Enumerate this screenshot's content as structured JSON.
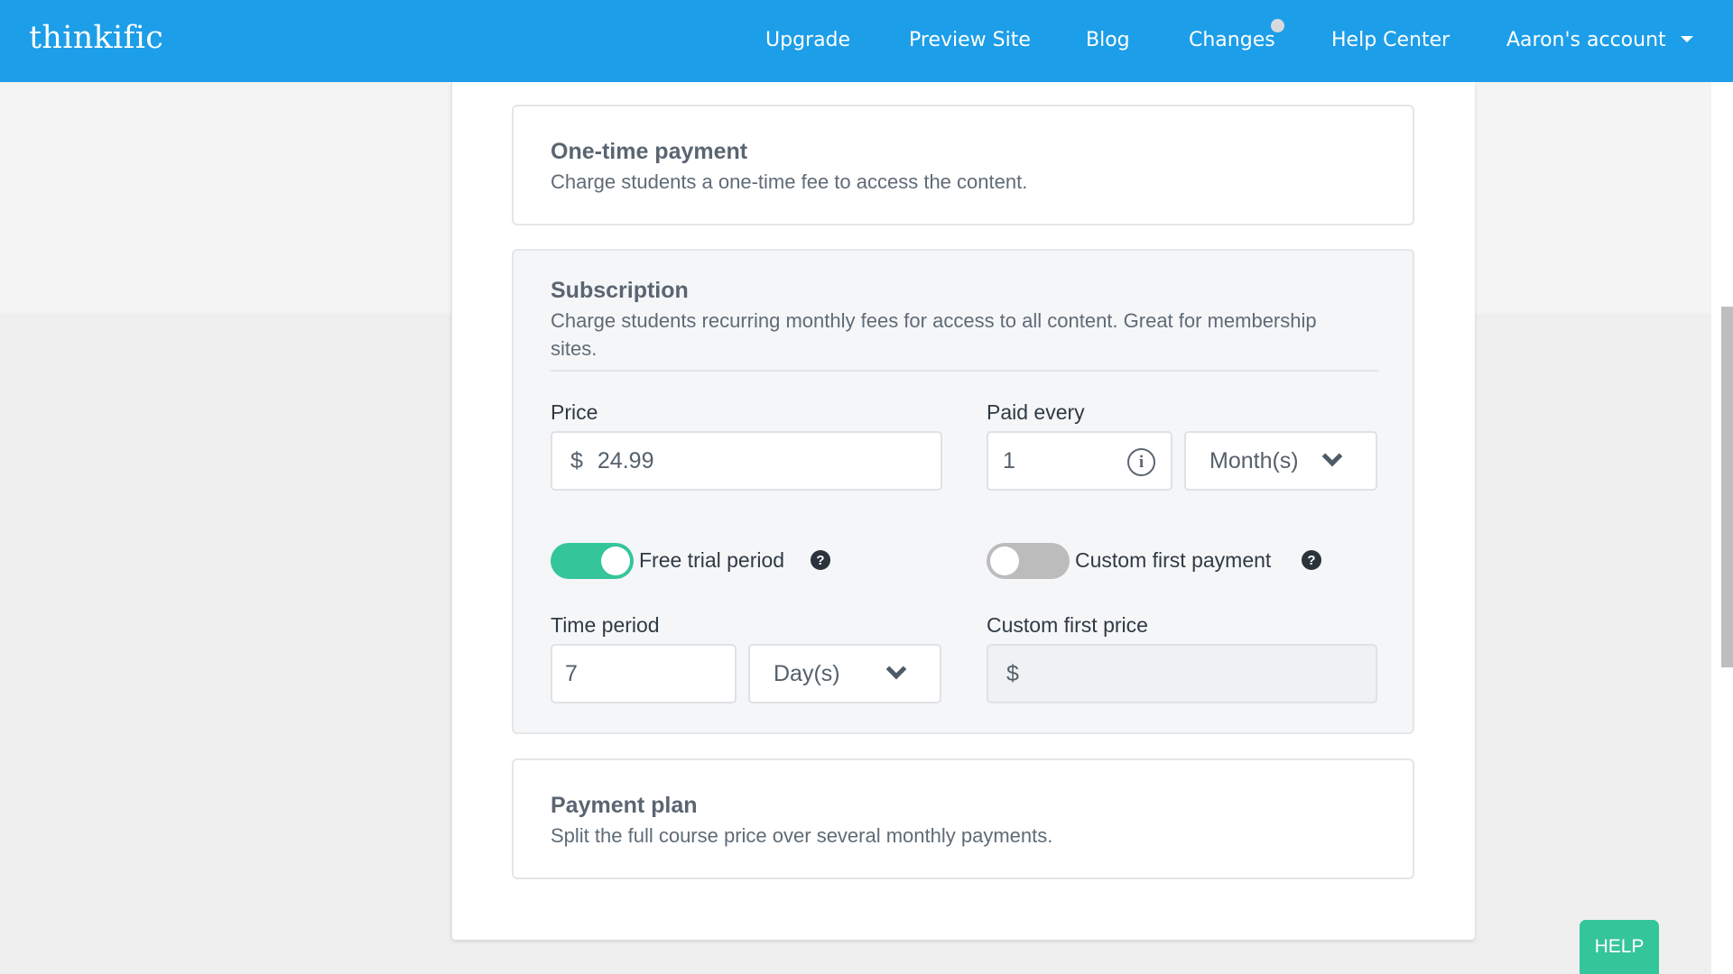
{
  "header": {
    "logo": "thinkific",
    "nav": [
      {
        "label": "Upgrade"
      },
      {
        "label": "Preview Site"
      },
      {
        "label": "Blog"
      },
      {
        "label": "Changes",
        "has_notification": true
      },
      {
        "label": "Help Center"
      }
    ],
    "account_label": "Aaron's account"
  },
  "options": {
    "one_time": {
      "title": "One-time payment",
      "description": "Charge students a one-time fee to access the content."
    },
    "subscription": {
      "title": "Subscription",
      "description": "Charge students recurring monthly fees for access to all content. Great for membership sites.",
      "price_label": "Price",
      "price_prefix": "$",
      "price_value": "24.99",
      "paid_every_label": "Paid every",
      "paid_every_value": "1",
      "paid_every_unit": "Month(s)",
      "free_trial_label": "Free trial period",
      "free_trial_enabled": true,
      "custom_first_payment_label": "Custom first payment",
      "custom_first_payment_enabled": false,
      "time_period_label": "Time period",
      "time_period_value": "7",
      "time_period_unit": "Day(s)",
      "custom_first_price_label": "Custom first price",
      "custom_first_price_prefix": "$",
      "custom_first_price_value": ""
    },
    "payment_plan": {
      "title": "Payment plan",
      "description": "Split the full course price over several monthly payments."
    }
  },
  "help_button": "HELP",
  "icons": {
    "info": "i",
    "question": "?"
  },
  "colors": {
    "brand": "#1d9ee8",
    "toggle_on": "#35c59a",
    "toggle_off": "#bcbcbc",
    "help_button": "#35c59a"
  }
}
